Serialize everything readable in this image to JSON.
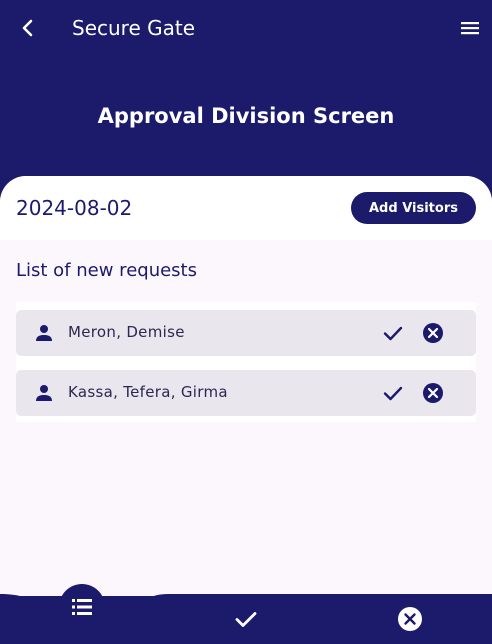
{
  "appbar": {
    "title": "Secure Gate",
    "back_icon": "arrow-back-icon",
    "menu_icon": "hamburger-menu-icon"
  },
  "screen": {
    "title": "Approval Division Screen"
  },
  "sheet": {
    "date": "2024-08-02",
    "add_visitors_label": "Add Visitors",
    "list_title": "List of new requests"
  },
  "requests": [
    {
      "name": "Meron, Demise",
      "icon": "person-icon"
    },
    {
      "name": "Kassa, Tefera, Girma",
      "icon": "person-icon"
    }
  ],
  "bottom_nav": {
    "items": [
      {
        "icon": "list-icon"
      },
      {
        "icon": "checkmark-icon"
      },
      {
        "icon": "cancel-circle-icon"
      }
    ]
  },
  "colors": {
    "primary": "#1c1a6b",
    "surface": "#fcf6fd",
    "item_bg": "#e9e6ee",
    "white": "#ffffff"
  }
}
